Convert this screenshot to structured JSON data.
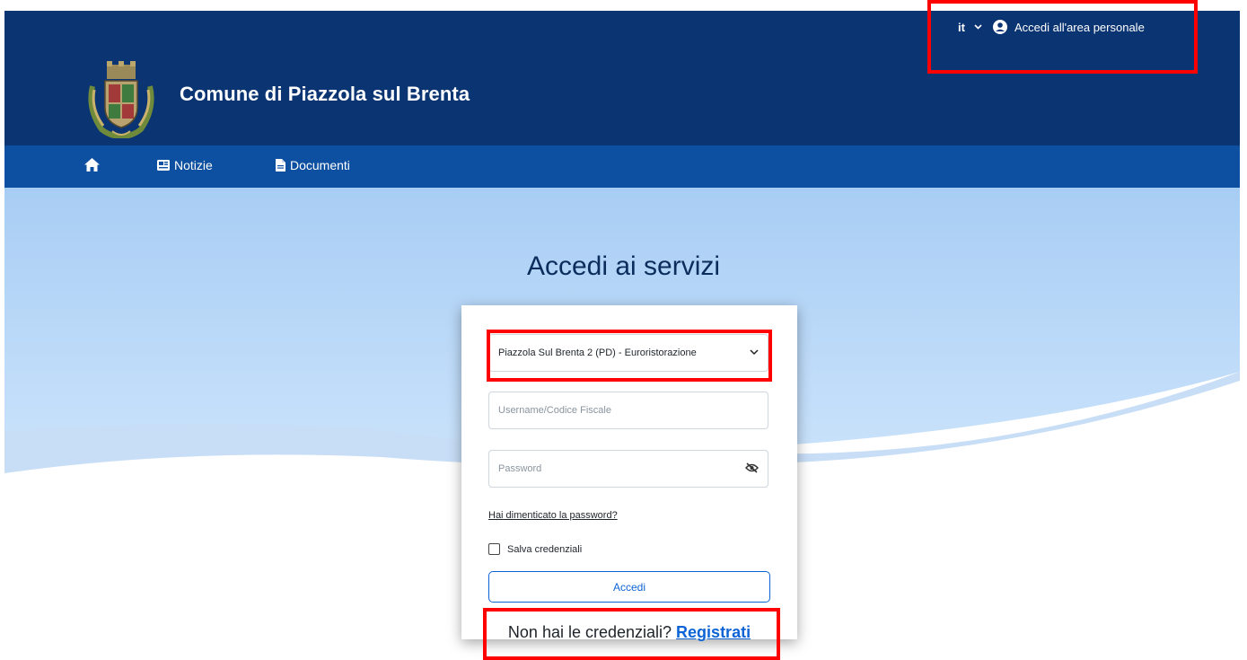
{
  "header": {
    "title": "Comune di Piazzola sul Brenta",
    "language": "it",
    "login_link": "Accedi all'area personale"
  },
  "nav": {
    "items": [
      {
        "label": "",
        "icon": "home-icon"
      },
      {
        "label": "Notizie",
        "icon": "newspaper-icon"
      },
      {
        "label": "Documenti",
        "icon": "document-icon"
      }
    ]
  },
  "main": {
    "page_title": "Accedi ai servizi"
  },
  "login": {
    "service_select": "Piazzola Sul Brenta 2 (PD) - Euroristorazione",
    "username_placeholder": "Username/Codice Fiscale",
    "password_placeholder": "Password",
    "forgot_password": "Hai dimenticato la password?",
    "save_credentials": "Salva credenziali",
    "submit_label": "Accedi",
    "no_credentials_text": "Non hai le credenziali?",
    "register_link": "Registrati"
  },
  "colors": {
    "header_bg": "#0b3473",
    "nav_bg": "#0d4fa0",
    "accent": "#0d63d6",
    "highlight": "#ff0000"
  }
}
